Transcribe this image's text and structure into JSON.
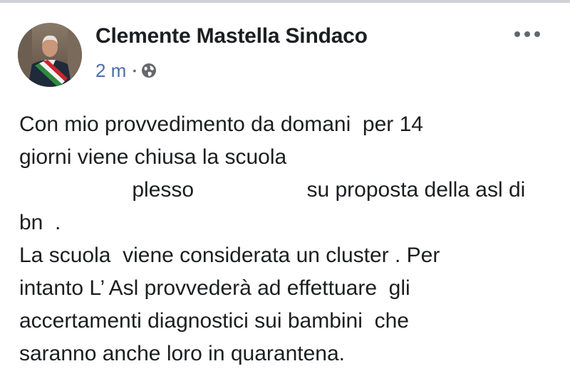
{
  "post": {
    "author": "Clemente Mastella Sindaco",
    "time": "2 m",
    "separator": "•",
    "privacy_icon": "globe-icon",
    "more_icon": "more-options-icon",
    "lines": [
      "Con mio provvedimento da domani  per 14",
      "giorni viene chiusa la scuola",
      "                   plesso                   su proposta della asl di",
      "bn  .",
      "La scuola  viene considerata un cluster . Per",
      "intanto L’ Asl provvederà ad effettuare  gli",
      "accertamenti diagnostici sui bambini  che",
      "saranno anche loro in quarantena."
    ]
  },
  "colors": {
    "link_blue": "#4b6ea9",
    "text": "#1c1e21",
    "icon_gray": "#606770"
  }
}
